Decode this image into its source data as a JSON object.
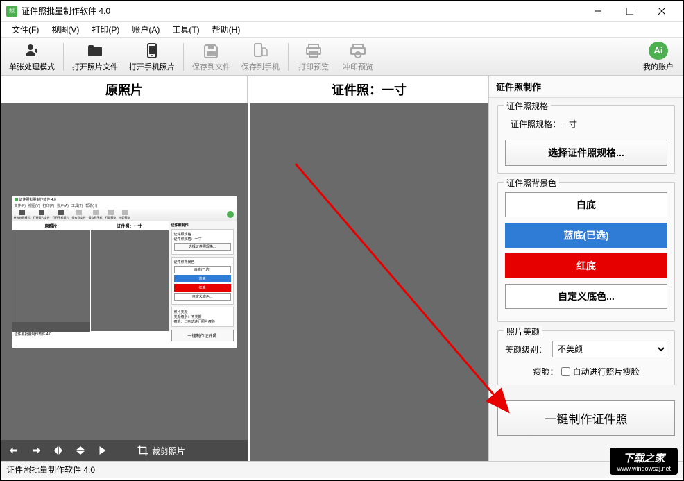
{
  "title": "证件照批量制作软件 4.0",
  "menu": {
    "file": "文件(F)",
    "view": "视图(V)",
    "print": "打印(P)",
    "account": "账户(A)",
    "tools": "工具(T)",
    "help": "帮助(H)"
  },
  "toolbar": {
    "mode": "单张处理模式",
    "open_file": "打开照片文件",
    "open_phone": "打开手机照片",
    "save_file": "保存到文件",
    "save_phone": "保存到手机",
    "print_preview": "打印预览",
    "dev_preview": "冲印预览",
    "my_account": "我的账户"
  },
  "panels": {
    "original": "原照片",
    "idphoto": "证件照：一寸"
  },
  "crop_label": "裁剪照片",
  "right": {
    "header": "证件照制作",
    "spec_group": "证件照规格",
    "spec_text": "证件照规格：一寸",
    "select_spec": "选择证件照规格...",
    "bg_group": "证件照背景色",
    "bg_white": "白底",
    "bg_blue": "蓝底(已选)",
    "bg_red": "红底",
    "bg_custom": "自定义底色...",
    "beauty_group": "照片美颜",
    "beauty_level_label": "美颜级别：",
    "beauty_level_value": "不美颜",
    "face_slim_label": "瘦脸：",
    "face_slim_check": "自动进行照片瘦脸",
    "action": "一键制作证件照"
  },
  "thumb": {
    "white_selected": "白底(已选)",
    "blue": "蓝底",
    "red": "红底",
    "custom": "自定义底色...",
    "beauty_none": "不美颜",
    "auto_slim": "自动进行照片瘦脸"
  },
  "status": "证件照批量制作软件 4.0",
  "watermark": {
    "main": "下载之家",
    "sub": "www.windowszj.net"
  }
}
